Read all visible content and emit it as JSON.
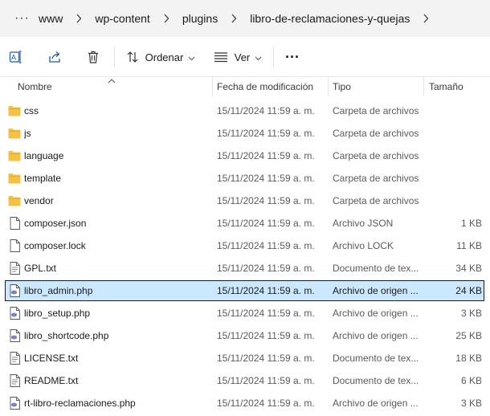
{
  "breadcrumb": {
    "overflow_label": "···",
    "items": [
      "www",
      "wp-content",
      "plugins",
      "libro-de-reclamaciones-y-quejas"
    ]
  },
  "toolbar": {
    "rename_icon": "rename-icon",
    "share_icon": "share-icon",
    "delete_icon": "trash-icon",
    "sort_label": "Ordenar",
    "view_label": "Ver",
    "more_label": "···"
  },
  "columns": {
    "name": "Nombre",
    "date": "Fecha de modificación",
    "type": "Tipo",
    "size": "Tamaño"
  },
  "colors": {
    "folder": "#f5c145",
    "php": "#7b7fc4",
    "selection": "#cce8ff"
  },
  "files": [
    {
      "icon": "folder-icon",
      "name": "css",
      "date": "15/11/2024 11:59 a. m.",
      "type": "Carpeta de archivos",
      "size": ""
    },
    {
      "icon": "folder-icon",
      "name": "js",
      "date": "15/11/2024 11:59 a. m.",
      "type": "Carpeta de archivos",
      "size": ""
    },
    {
      "icon": "folder-icon",
      "name": "language",
      "date": "15/11/2024 11:59 a. m.",
      "type": "Carpeta de archivos",
      "size": ""
    },
    {
      "icon": "folder-icon",
      "name": "template",
      "date": "15/11/2024 11:59 a. m.",
      "type": "Carpeta de archivos",
      "size": ""
    },
    {
      "icon": "folder-icon",
      "name": "vendor",
      "date": "15/11/2024 11:59 a. m.",
      "type": "Carpeta de archivos",
      "size": ""
    },
    {
      "icon": "file-icon",
      "name": "composer.json",
      "date": "15/11/2024 11:59 a. m.",
      "type": "Archivo JSON",
      "size": "1 KB"
    },
    {
      "icon": "file-icon",
      "name": "composer.lock",
      "date": "15/11/2024 11:59 a. m.",
      "type": "Archivo LOCK",
      "size": "11 KB"
    },
    {
      "icon": "text-file-icon",
      "name": "GPL.txt",
      "date": "15/11/2024 11:59 a. m.",
      "type": "Documento de tex...",
      "size": "34 KB"
    },
    {
      "icon": "php-file-icon",
      "name": "libro_admin.php",
      "date": "15/11/2024 11:59 a. m.",
      "type": "Archivo de origen ...",
      "size": "24 KB",
      "selected": true
    },
    {
      "icon": "php-file-icon",
      "name": "libro_setup.php",
      "date": "15/11/2024 11:59 a. m.",
      "type": "Archivo de origen ...",
      "size": "3 KB"
    },
    {
      "icon": "php-file-icon",
      "name": "libro_shortcode.php",
      "date": "15/11/2024 11:59 a. m.",
      "type": "Archivo de origen ...",
      "size": "25 KB"
    },
    {
      "icon": "text-file-icon",
      "name": "LICENSE.txt",
      "date": "15/11/2024 11:59 a. m.",
      "type": "Documento de tex...",
      "size": "18 KB"
    },
    {
      "icon": "text-file-icon",
      "name": "README.txt",
      "date": "15/11/2024 11:59 a. m.",
      "type": "Documento de tex...",
      "size": "6 KB"
    },
    {
      "icon": "php-file-icon",
      "name": "rt-libro-reclamaciones.php",
      "date": "15/11/2024 11:59 a. m.",
      "type": "Archivo de origen ...",
      "size": "3 KB"
    }
  ]
}
